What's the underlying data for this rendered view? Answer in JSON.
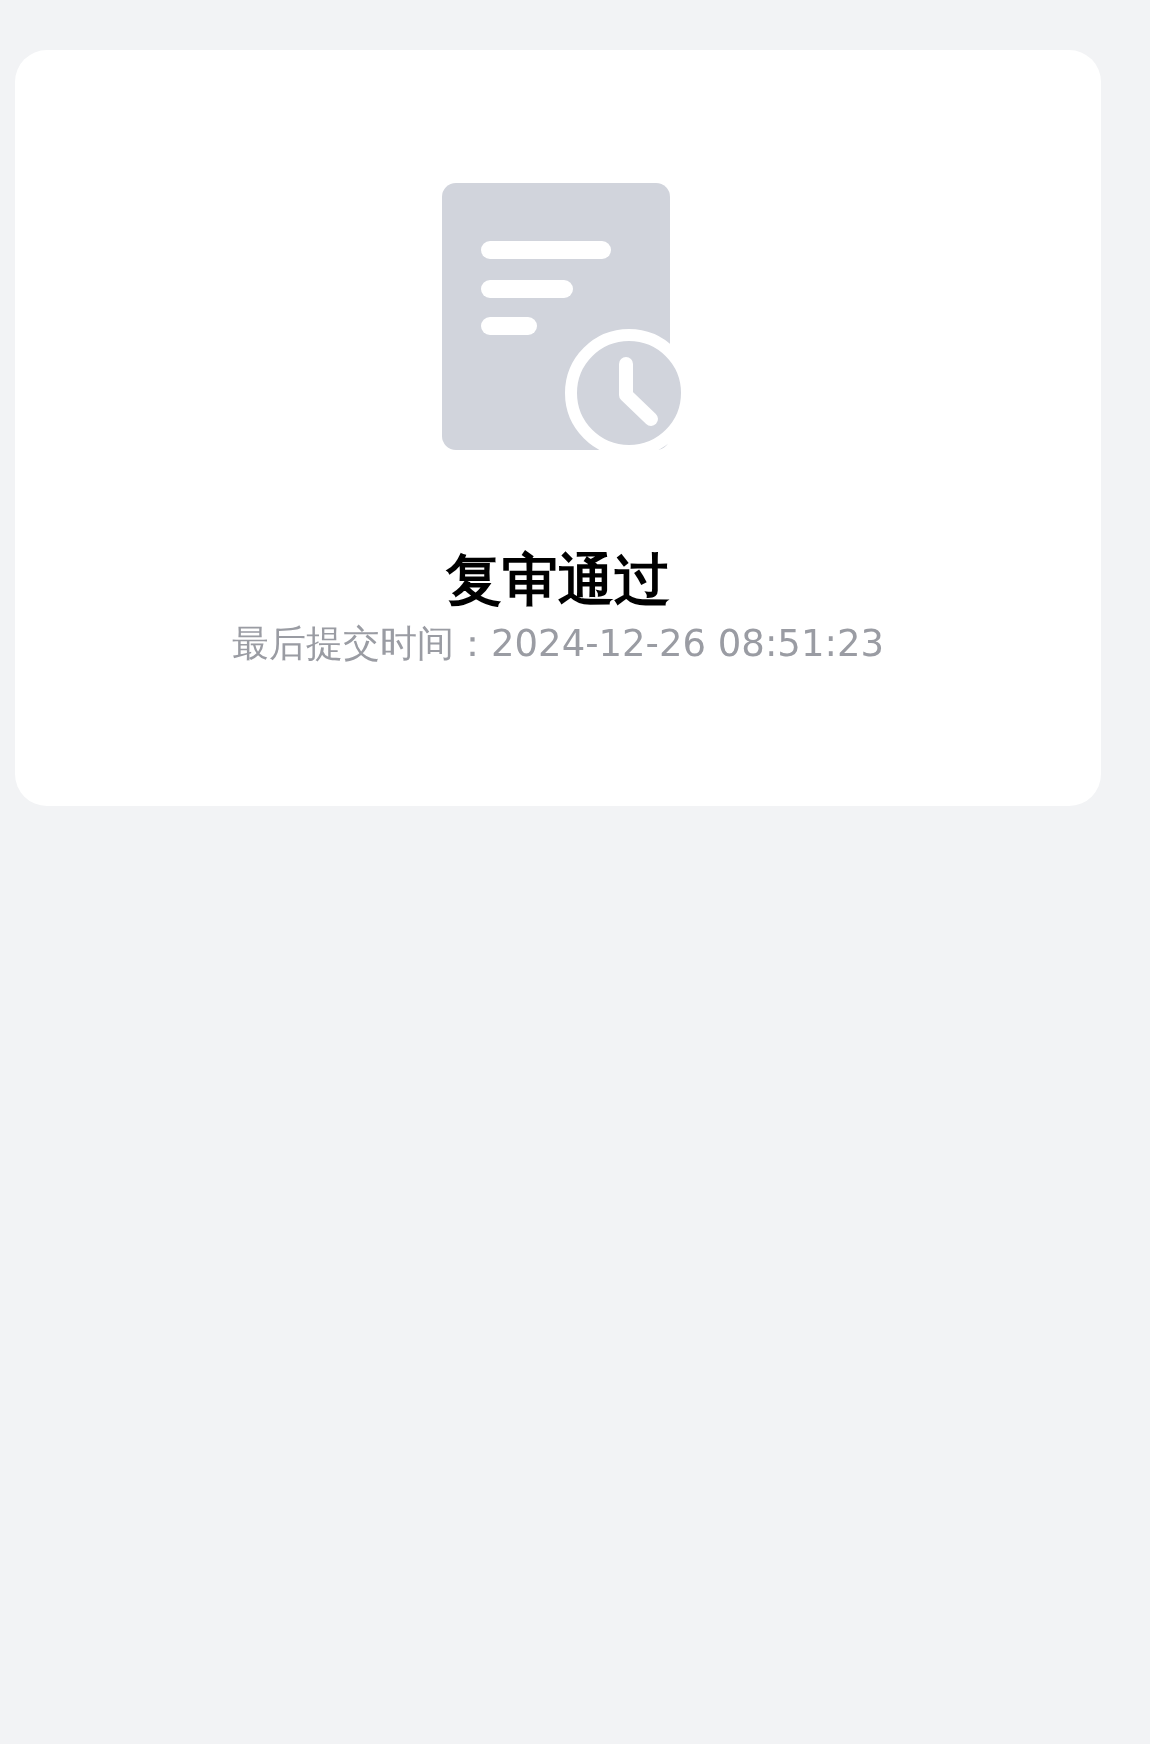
{
  "status_card": {
    "title": "复审通过",
    "subtitle": "最后提交时间：2024-12-26 08:51:23"
  }
}
